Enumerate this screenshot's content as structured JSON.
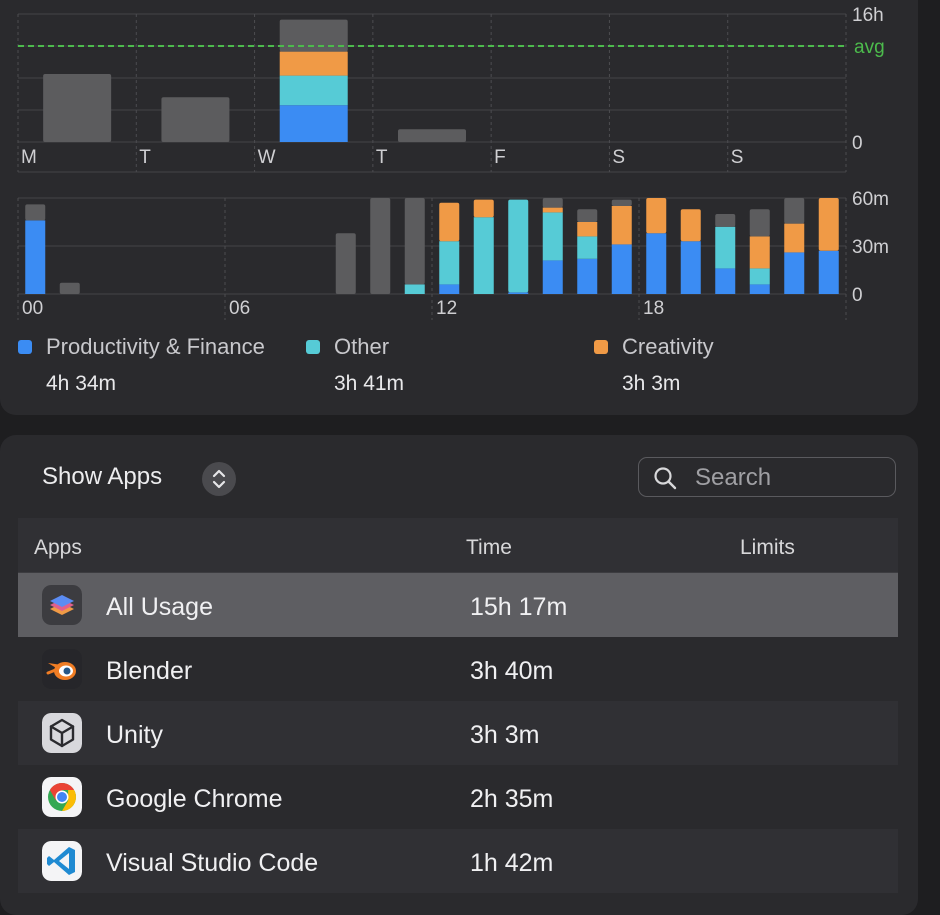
{
  "weekly_chart": {
    "y_ticks": [
      "16h",
      "avg",
      "0"
    ],
    "days": [
      "M",
      "T",
      "W",
      "T",
      "F",
      "S",
      "S"
    ]
  },
  "hourly_chart": {
    "y_ticks": [
      "60m",
      "30m",
      "0"
    ],
    "hour_labels": [
      "00",
      "06",
      "12",
      "18"
    ]
  },
  "legend": [
    {
      "label": "Productivity & Finance",
      "value": "4h 34m",
      "color": "#3b8cf3"
    },
    {
      "label": "Other",
      "value": "3h 41m",
      "color": "#56cbd6"
    },
    {
      "label": "Creativity",
      "value": "3h 3m",
      "color": "#f09a46"
    }
  ],
  "colors": {
    "productivity": "#3b8cf3",
    "other": "#56cbd6",
    "creativity": "#f09a46",
    "uncategorized": "#5c5c5e",
    "average_line": "#4cbb4c"
  },
  "controls": {
    "show_apps_label": "Show Apps",
    "search_placeholder": "Search"
  },
  "table": {
    "headers": {
      "apps": "Apps",
      "time": "Time",
      "limits": "Limits"
    },
    "rows": [
      {
        "name": "All Usage",
        "time": "15h 17m",
        "icon": "all-usage-icon"
      },
      {
        "name": "Blender",
        "time": "3h 40m",
        "icon": "blender-icon"
      },
      {
        "name": "Unity",
        "time": "3h 3m",
        "icon": "unity-icon"
      },
      {
        "name": "Google Chrome",
        "time": "2h 35m",
        "icon": "chrome-icon"
      },
      {
        "name": "Visual Studio Code",
        "time": "1h 42m",
        "icon": "vscode-icon"
      }
    ]
  },
  "chart_data": [
    {
      "type": "bar",
      "stacked": true,
      "categories": [
        "M",
        "T",
        "W",
        "T",
        "F",
        "S",
        "S"
      ],
      "ylim": [
        0,
        16
      ],
      "y_unit": "h",
      "average": 12,
      "grid": true,
      "series": [
        {
          "key": "productivity",
          "values": [
            0,
            0,
            4.6,
            0,
            0,
            0,
            0
          ]
        },
        {
          "key": "other",
          "values": [
            0,
            0,
            3.7,
            0,
            0,
            0,
            0
          ]
        },
        {
          "key": "creativity",
          "values": [
            0,
            0,
            3.0,
            0,
            0,
            0,
            0
          ]
        },
        {
          "key": "uncategorized",
          "values": [
            8.5,
            5.6,
            4.0,
            1.6,
            0,
            0,
            0
          ]
        }
      ]
    },
    {
      "type": "bar",
      "stacked": true,
      "categories": [
        "0",
        "1",
        "2",
        "3",
        "4",
        "5",
        "6",
        "7",
        "8",
        "9",
        "10",
        "11",
        "12",
        "13",
        "14",
        "15",
        "16",
        "17",
        "18",
        "19",
        "20",
        "21",
        "22",
        "23"
      ],
      "ylim": [
        0,
        60
      ],
      "y_unit": "m",
      "grid": true,
      "series": [
        {
          "key": "productivity",
          "values": [
            46,
            0,
            0,
            0,
            0,
            0,
            0,
            0,
            0,
            0,
            0,
            0,
            6,
            0,
            1,
            21,
            22,
            31,
            38,
            33,
            16,
            6,
            26,
            27
          ]
        },
        {
          "key": "other",
          "values": [
            0,
            0,
            0,
            0,
            0,
            0,
            0,
            0,
            0,
            0,
            0,
            6,
            27,
            48,
            58,
            30,
            14,
            0,
            0,
            0,
            26,
            10,
            0,
            0
          ]
        },
        {
          "key": "creativity",
          "values": [
            0,
            0,
            0,
            0,
            0,
            0,
            0,
            0,
            0,
            0,
            0,
            0,
            24,
            11,
            0,
            3,
            9,
            24,
            22,
            20,
            0,
            20,
            18,
            33
          ]
        },
        {
          "key": "uncategorized",
          "values": [
            10,
            7,
            0,
            0,
            0,
            0,
            0,
            0,
            0,
            38,
            60,
            54,
            0,
            0,
            0,
            6,
            8,
            4,
            0,
            0,
            8,
            17,
            16,
            0
          ]
        }
      ]
    }
  ]
}
